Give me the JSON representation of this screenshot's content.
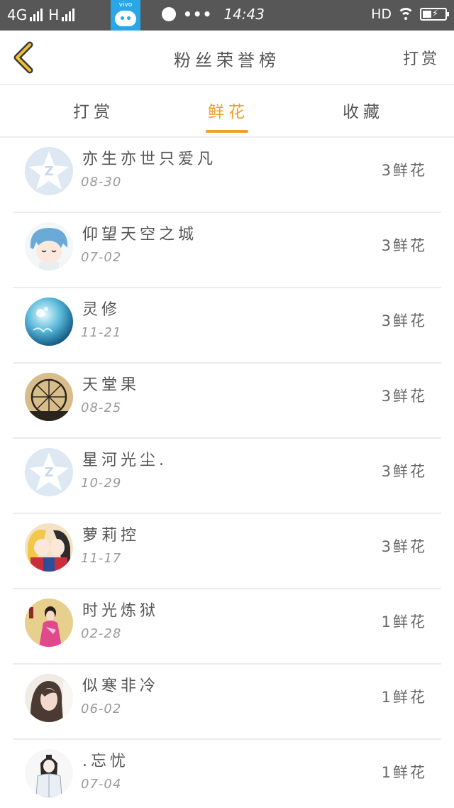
{
  "status_bar": {
    "network": "4G",
    "network2": "H",
    "app_badge": "vivo",
    "dots": "•••",
    "time": "14:43",
    "hd": "HD"
  },
  "header": {
    "title": "粉丝荣誉榜",
    "action": "打赏"
  },
  "tabs": [
    {
      "label": "打赏",
      "active": false
    },
    {
      "label": "鲜花",
      "active": true
    },
    {
      "label": "收藏",
      "active": false
    }
  ],
  "fans": [
    {
      "name": "亦生亦世只爱凡",
      "date": "08-30",
      "count": "3鲜花",
      "avatar": "default-qq"
    },
    {
      "name": "仰望天空之城",
      "date": "07-02",
      "count": "3鲜花",
      "avatar": "anime-blue-hair"
    },
    {
      "name": "灵修",
      "date": "11-21",
      "count": "3鲜花",
      "avatar": "blue-floral"
    },
    {
      "name": "天堂果",
      "date": "08-25",
      "count": "3鲜花",
      "avatar": "ferris-wheel"
    },
    {
      "name": "星河光尘.",
      "date": "10-29",
      "count": "3鲜花",
      "avatar": "default-qq"
    },
    {
      "name": "萝莉控",
      "date": "11-17",
      "count": "3鲜花",
      "avatar": "anime-girls"
    },
    {
      "name": "时光炼狱",
      "date": "02-28",
      "count": "1鲜花",
      "avatar": "girl-pink-dress"
    },
    {
      "name": "似寒非冷",
      "date": "06-02",
      "count": "1鲜花",
      "avatar": "girl-portrait"
    },
    {
      "name": ".忘忧",
      "date": "07-04",
      "count": "1鲜花",
      "avatar": "ink-character"
    }
  ],
  "colors": {
    "accent": "#f0a02a",
    "status_bar": "#575757",
    "divider": "#eeeeee"
  }
}
